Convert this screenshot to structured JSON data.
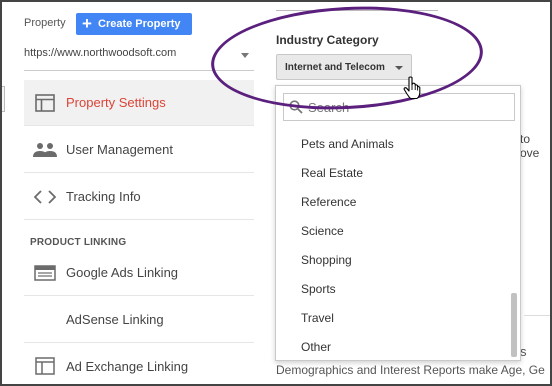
{
  "header": {
    "property_label": "Property",
    "create_property_label": "Create Property",
    "create_icon": "+",
    "property_url": "https://www.northwoodsoft.com"
  },
  "nav": {
    "items": [
      {
        "label": "Property Settings",
        "icon": "layout-icon",
        "active": true
      },
      {
        "label": "User Management",
        "icon": "people-icon"
      },
      {
        "label": "Tracking Info",
        "icon": "code-icon"
      }
    ],
    "section_heading": "PRODUCT LINKING",
    "linking_items": [
      {
        "label": "Google Ads Linking",
        "icon": "ads-panel-icon"
      },
      {
        "label": "AdSense Linking",
        "icon": ""
      },
      {
        "label": "Ad Exchange Linking",
        "icon": "exchange-icon"
      }
    ]
  },
  "industry": {
    "label": "Industry Category",
    "selected": "Internet and Telecom"
  },
  "dropdown": {
    "search_placeholder": "Search",
    "options": [
      "Pets and Animals",
      "Real Estate",
      "Reference",
      "Science",
      "Shopping",
      "Sports",
      "Travel",
      "Other"
    ]
  },
  "background_text": {
    "cut_right": "to ove",
    "cut_s": "s",
    "demographics": "Demographics and Interest Reports make Age, Ge"
  },
  "colors": {
    "accent_blue": "#4285f4",
    "active_red": "#db4437",
    "highlight_purple": "#5b1f7d"
  }
}
